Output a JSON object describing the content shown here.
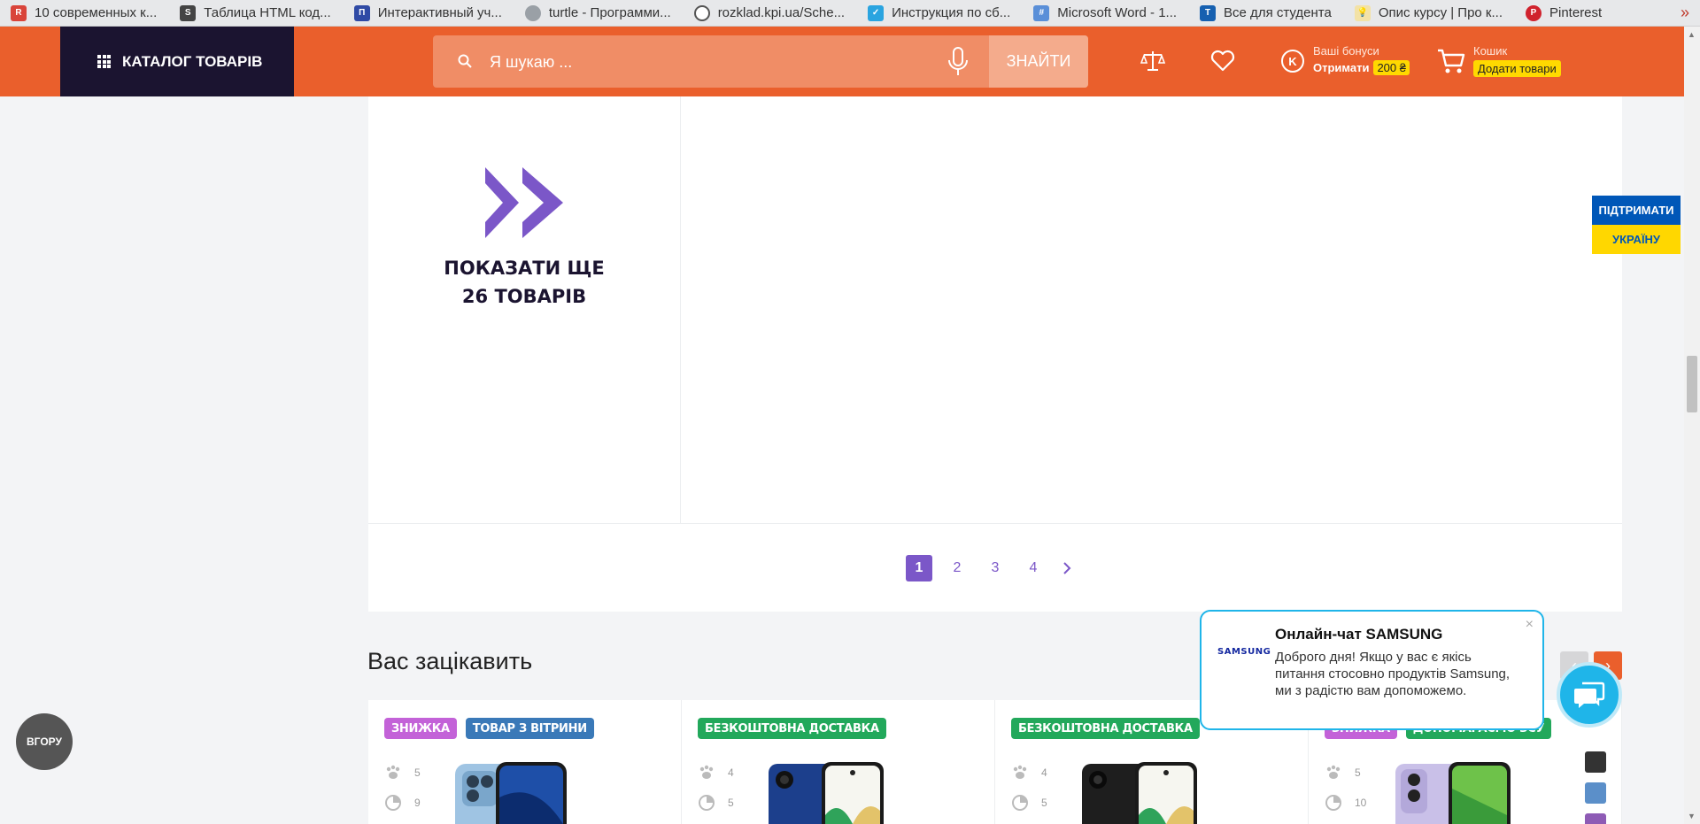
{
  "bookmarks": [
    {
      "label": "10 современных к...",
      "icon": "radio-bookmark-icon",
      "color": "#d9443a"
    },
    {
      "label": "Таблица HTML код...",
      "icon": "stm-bookmark-icon",
      "color": "#444"
    },
    {
      "label": "Интерактивный уч...",
      "icon": "blue-square-bookmark-icon",
      "color": "#2f4aa5"
    },
    {
      "label": "turtle - Программи...",
      "icon": "globe-bookmark-icon",
      "color": "#9aa0a6"
    },
    {
      "label": "rozklad.kpi.ua/Sche...",
      "icon": "kpi-bookmark-icon",
      "color": "#555"
    },
    {
      "label": "Инструкция по сб...",
      "icon": "check-bookmark-icon",
      "color": "#2aa4e0"
    },
    {
      "label": "Microsoft Word - 1...",
      "icon": "hash-bookmark-icon",
      "color": "#5a8fd8"
    },
    {
      "label": "Все для студента",
      "icon": "t-bookmark-icon",
      "color": "#1660b0"
    },
    {
      "label": "Опис курсу | Про к...",
      "icon": "bulb-bookmark-icon",
      "color": "#e0b84a"
    },
    {
      "label": "Pinterest",
      "icon": "pinterest-bookmark-icon",
      "color": "#d0222d"
    }
  ],
  "bookmarks_more": "»",
  "header": {
    "catalog_label": "КАТАЛОГ ТОВАРІВ",
    "search_placeholder": "Я шукаю ...",
    "search_button": "ЗНАЙТИ",
    "bonus_title": "Ваші бонуси",
    "bonus_action": "Отримати",
    "bonus_amount": "200 ₴",
    "cart_title": "Кошик",
    "cart_action": "Додати товари",
    "accent_color": "#ea5f2c"
  },
  "show_more": {
    "line1": "ПОКАЗАТИ ЩЕ",
    "line2": "26 ТОВАРІВ",
    "icon": "double-chevron-right-icon",
    "icon_color": "#7b57c8"
  },
  "pagination": {
    "pages": [
      "1",
      "2",
      "3",
      "4"
    ],
    "active": "1",
    "next_icon": "chevron-right-icon"
  },
  "support_ukraine": {
    "line1": "ПІДТРИМАТИ",
    "line2": "УКРАЇНУ"
  },
  "section": {
    "title": "Вас зацікавить",
    "prev_icon": "chevron-left-icon",
    "next_icon": "chevron-right-icon"
  },
  "products": [
    {
      "tags": [
        {
          "label": "ЗНИЖКА",
          "color": "#c362d8"
        },
        {
          "label": "ТОВАР З ВІТРИНИ",
          "color": "#3a79b8"
        }
      ],
      "stat1": "5",
      "stat2": "9",
      "phone": "iphone-blue"
    },
    {
      "tags": [
        {
          "label": "БЕЗКОШТОВНА ДОСТАВКА",
          "color": "#22a85b"
        }
      ],
      "stat1": "4",
      "stat2": "5",
      "phone": "samsung-blue"
    },
    {
      "tags": [
        {
          "label": "БЕЗКОШТОВНА ДОСТАВКА",
          "color": "#22a85b"
        }
      ],
      "stat1": "4",
      "stat2": "5",
      "phone": "samsung-black"
    },
    {
      "tags": [
        {
          "label": "ЗНИЖКА",
          "color": "#c362d8"
        },
        {
          "label": "ДОПОМАГАЄМО ЗСУ",
          "color": "#22a85b"
        }
      ],
      "stat1": "5",
      "stat2": "10",
      "phone": "samsung-violet"
    }
  ],
  "chat": {
    "brand": "SAMSUNG",
    "title": "Онлайн-чат SAMSUNG",
    "text": "Доброго дня! Якщо у вас є якісь питання стосовно продуктів Samsung, ми з радістю вам допоможемо.",
    "close": "×"
  },
  "up_button": "ВГОРУ",
  "swatches": [
    "#333333",
    "#5b8fc9",
    "#8e5bb5"
  ]
}
